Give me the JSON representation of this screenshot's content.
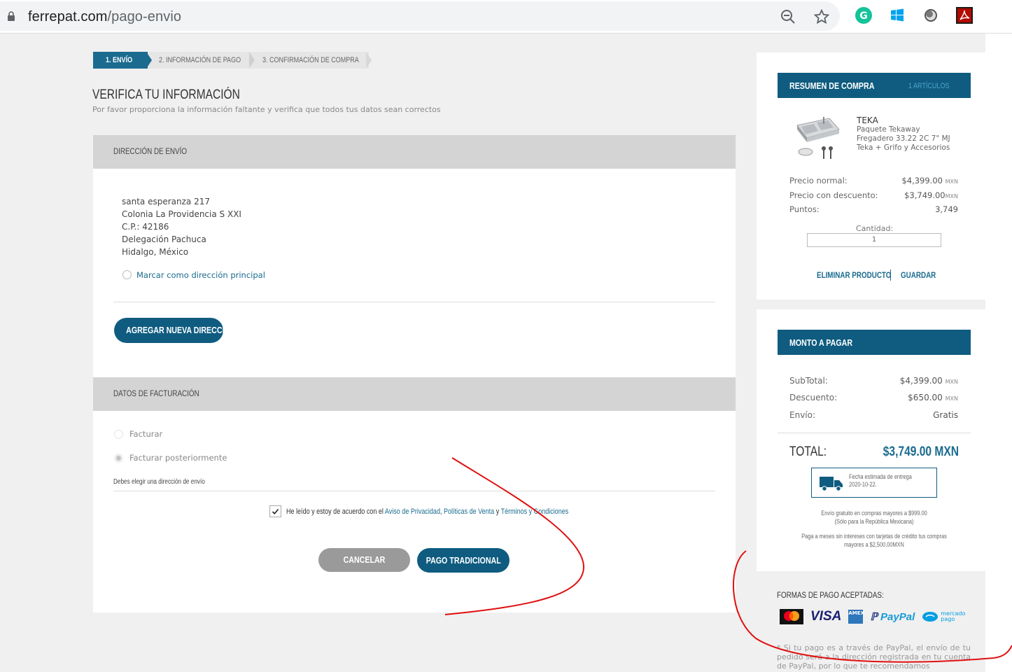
{
  "browser": {
    "url_domain": "ferrepat.com",
    "url_path": "/pago-envio",
    "icons": [
      "lock-icon",
      "zoom-out-icon",
      "star-icon",
      "grammarly-icon",
      "windows-icon",
      "extension-circle-icon",
      "acrobat-icon"
    ]
  },
  "steps": [
    {
      "label": "1. ENVÍO",
      "active": true
    },
    {
      "label": "2. INFORMACIÓN DE PAGO",
      "active": false
    },
    {
      "label": "3. CONFIRMACIÓN DE COMPRA",
      "active": false
    }
  ],
  "page": {
    "title": "VERIFICA TU INFORMACIÓN",
    "subtitle": "Por favor proporciona la información faltante y verifica que todos tus datos sean correctos"
  },
  "shipping": {
    "section_title": "DIRECCIÓN DE ENVÍO",
    "address_lines": [
      "santa esperanza 217",
      "Colonia La Providencia S XXI",
      "C.P.: 42186",
      "Delegación Pachuca",
      "Hidalgo, México"
    ],
    "mark_principal": "Marcar como dirección principal",
    "add_button": "AGREGAR NUEVA DIRECCIÓN"
  },
  "billing": {
    "section_title": "DATOS DE FACTURACIÓN",
    "option_invoice": "Facturar",
    "option_later": "Facturar posteriormente",
    "warning": "Debes elegir una dirección de envío",
    "terms_prefix": "He leído y estoy de acuerdo con el ",
    "terms_privacy": "Aviso de Privacidad",
    "terms_sep1": ", ",
    "terms_sales": "Políticas de Venta",
    "terms_sep2": " y ",
    "terms_conditions": "Términos y Condiciones",
    "terms_checked": true,
    "cancel_button": "CANCELAR",
    "pay_button": "PAGO TRADICIONAL"
  },
  "summary": {
    "title": "RESUMEN DE COMPRA",
    "count": "1 ARTÍCULOS",
    "brand": "TEKA",
    "product_name": "Paquete Tekaway Fregadero 33.22 2C 7\" MJ Teka + Grifo y Accesorios",
    "price_normal_label": "Precio normal:",
    "price_normal": "$4,399.00",
    "price_discount_label": "Precio con descuento:",
    "price_discount": "$3,749.00",
    "points_label": "Puntos:",
    "points": "3,749",
    "currency": "MXN",
    "qty_label": "Cantidad:",
    "qty": "1",
    "remove": "ELIMINAR PRODUCTO",
    "save": "GUARDAR"
  },
  "amount": {
    "title": "MONTO A PAGAR",
    "subtotal_label": "SubTotal:",
    "subtotal": "$4,399.00",
    "discount_label": "Descuento:",
    "discount": "$650.00",
    "shipping_label": "Envío:",
    "shipping": "Gratis",
    "currency": "MXN",
    "total_label": "TOTAL:",
    "total": "$3,749.00 MXN",
    "delivery_label": "Fecha estimada de entrega",
    "delivery_date": "2020-10-22.",
    "note_free_1": "Envío gratuito en compras mayores a $999.00",
    "note_free_2": "(Sólo para la República Mexicana)",
    "note_msi_1": "Paga a meses sin intereses con tarjetas de crédito tus compras",
    "note_msi_2": "mayores a $2,500.00MXN"
  },
  "payment": {
    "title": "FORMAS DE PAGO ACEPTADAS:",
    "logos": [
      "mastercard",
      "VISA",
      "AMEX",
      "PayPal",
      "mercado pago"
    ],
    "paypal_note": "* Si tu pago es a través de PayPal, el envío de tu pedido será a la dirección registrada en tu cuenta de PayPal, por lo que te recomendamos"
  },
  "colors": {
    "accent": "#0f5c80",
    "link": "#1a6b8f",
    "annotation": "#e01010"
  }
}
